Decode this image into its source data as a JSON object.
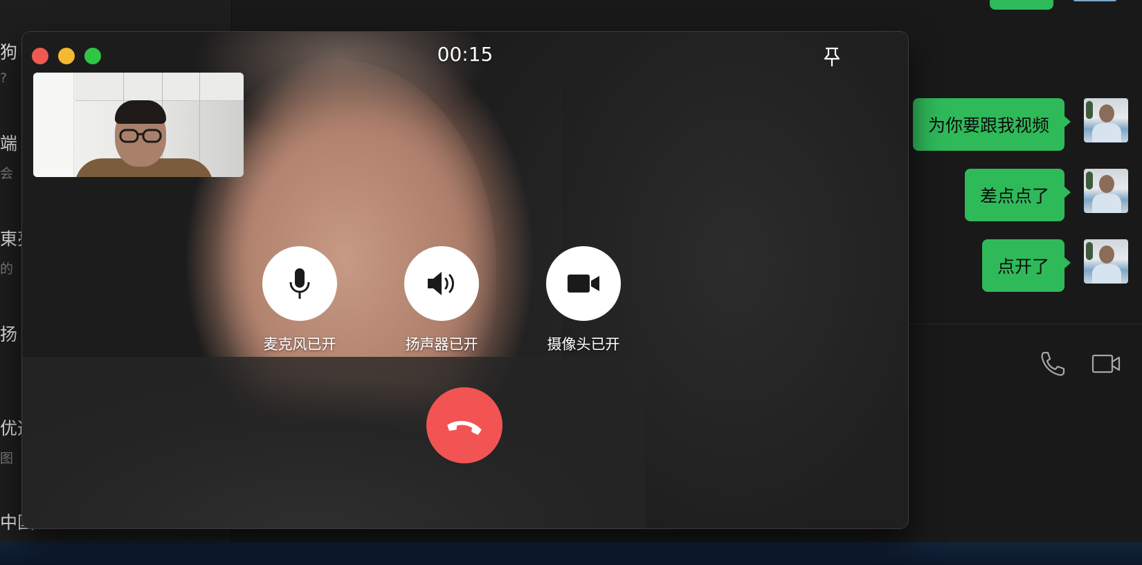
{
  "sidebar": {
    "chats": [
      {
        "name": "狗",
        "sub": "?"
      },
      {
        "name": "端",
        "sub": "会"
      },
      {
        "name": "東亮",
        "sub": "的"
      },
      {
        "name": "扬",
        "sub": ""
      },
      {
        "name": "优选",
        "sub": "图"
      },
      {
        "name": "中国",
        "sub": ""
      }
    ]
  },
  "messages": [
    {
      "text": "为你要跟我视频"
    },
    {
      "text": "差点点了"
    },
    {
      "text": "点开了"
    }
  ],
  "chat_toolbar": {
    "voice_call_icon": "phone-icon",
    "video_call_icon": "video-camera-icon"
  },
  "call": {
    "timer": "00:15",
    "pin_icon": "pin-icon",
    "controls": {
      "mic_label": "麦克风已开",
      "speaker_label": "扬声器已开",
      "camera_label": "摄像头已开"
    },
    "hangup_icon": "hang-up-icon",
    "colors": {
      "hangup": "#f25454",
      "close": "#ee5a52",
      "minimize": "#f5b833",
      "zoom": "#2fc545",
      "bubble": "#2fba5a"
    }
  }
}
